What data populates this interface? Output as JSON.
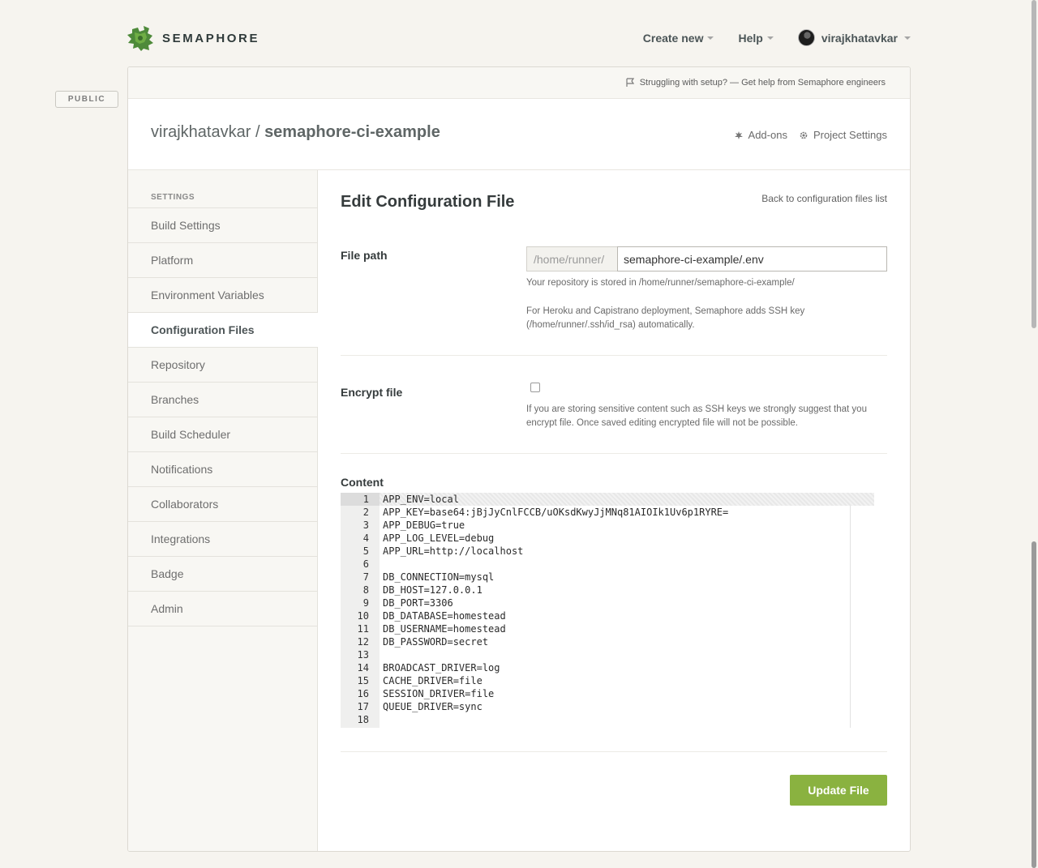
{
  "brand": {
    "name": "SEMAPHORE",
    "colors": {
      "accent": "#8ab240",
      "logo": "#4e8a3a"
    }
  },
  "nav": {
    "create_new": "Create new",
    "help": "Help",
    "username": "virajkhatavkar"
  },
  "public_badge": "PUBLIC",
  "help_bar": {
    "text": "Struggling with setup? — Get help from Semaphore engineers"
  },
  "project": {
    "owner": "virajkhatavkar",
    "separator": " / ",
    "repo": "semaphore-ci-example",
    "links": {
      "addons": "Add-ons",
      "settings": "Project Settings"
    }
  },
  "sidebar": {
    "heading": "SETTINGS",
    "items": [
      {
        "label": "Build Settings"
      },
      {
        "label": "Platform"
      },
      {
        "label": "Environment Variables"
      },
      {
        "label": "Configuration Files",
        "active": true
      },
      {
        "label": "Repository"
      },
      {
        "label": "Branches"
      },
      {
        "label": "Build Scheduler"
      },
      {
        "label": "Notifications"
      },
      {
        "label": "Collaborators"
      },
      {
        "label": "Integrations"
      },
      {
        "label": "Badge"
      },
      {
        "label": "Admin"
      }
    ]
  },
  "main": {
    "title": "Edit Configuration File",
    "back_link": "Back to configuration files list",
    "file_path": {
      "label": "File path",
      "prefix": "/home/runner/",
      "value": "semaphore-ci-example/.env",
      "help1": "Your repository is stored in /home/runner/semaphore-ci-example/",
      "help2": "For Heroku and Capistrano deployment, Semaphore adds SSH key (/home/runner/.ssh/id_rsa) automatically."
    },
    "encrypt": {
      "label": "Encrypt file",
      "checked": false,
      "help": "If you are storing sensitive content such as SSH keys we strongly suggest that you encrypt file. Once saved editing encrypted file will not be possible."
    },
    "content": {
      "label": "Content",
      "lines": [
        "APP_ENV=local",
        "APP_KEY=base64:jBjJyCnlFCCB/uOKsdKwyJjMNq81AIOIk1Uv6p1RYRE=",
        "APP_DEBUG=true",
        "APP_LOG_LEVEL=debug",
        "APP_URL=http://localhost",
        "",
        "DB_CONNECTION=mysql",
        "DB_HOST=127.0.0.1",
        "DB_PORT=3306",
        "DB_DATABASE=homestead",
        "DB_USERNAME=homestead",
        "DB_PASSWORD=secret",
        "",
        "BROADCAST_DRIVER=log",
        "CACHE_DRIVER=file",
        "SESSION_DRIVER=file",
        "QUEUE_DRIVER=sync",
        ""
      ]
    },
    "update_button": "Update File"
  }
}
